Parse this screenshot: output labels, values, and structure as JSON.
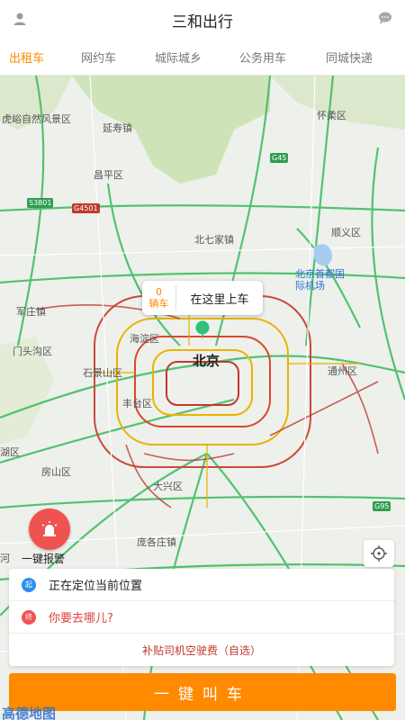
{
  "header": {
    "title": "三和出行"
  },
  "tabs": [
    {
      "label": "出租车",
      "active": true
    },
    {
      "label": "网约车",
      "active": false
    },
    {
      "label": "城际城乡",
      "active": false
    },
    {
      "label": "公务用车",
      "active": false
    },
    {
      "label": "同城快递",
      "active": false
    }
  ],
  "map": {
    "center_city": "北京",
    "labels": {
      "huyu": "虎峪自然风景区",
      "yanshou": "延寿镇",
      "huairou": "怀柔区",
      "changping": "昌平区",
      "beiqijia": "北七家镇",
      "shunyi": "顺义区",
      "airport": "北京首都国际机场",
      "wangzhuang": "军庄镇",
      "mentougou": "门头沟区",
      "haidian": "海淀区",
      "shijingshan": "石景山区",
      "fengtai": "丰台区",
      "tongzhou": "通州区",
      "hu": "湖区",
      "fangshan": "房山区",
      "daxing": "大兴区",
      "pangge": "庞各庄镇",
      "he": "河"
    },
    "road_badges": [
      "G45",
      "S3801",
      "G4501",
      "G95"
    ]
  },
  "bubble": {
    "count": "0",
    "unit": "辆车",
    "here": "在这里上车"
  },
  "alarm": {
    "label": "一键报警"
  },
  "route": {
    "start_badge": "起",
    "start_text": "正在定位当前位置",
    "end_badge": "终",
    "end_text": "你要去哪儿?",
    "fee_text": "补贴司机空驶费（自选）"
  },
  "call_button": "一键叫车",
  "map_logo": "高德地图",
  "colors": {
    "accent": "#ff8a00",
    "start": "#2b8ef0",
    "end": "#ef5350",
    "alarm": "#ef5350"
  },
  "icons": [
    "user-icon",
    "chat-icon",
    "location-pin-icon",
    "alarm-icon",
    "locate-icon"
  ]
}
